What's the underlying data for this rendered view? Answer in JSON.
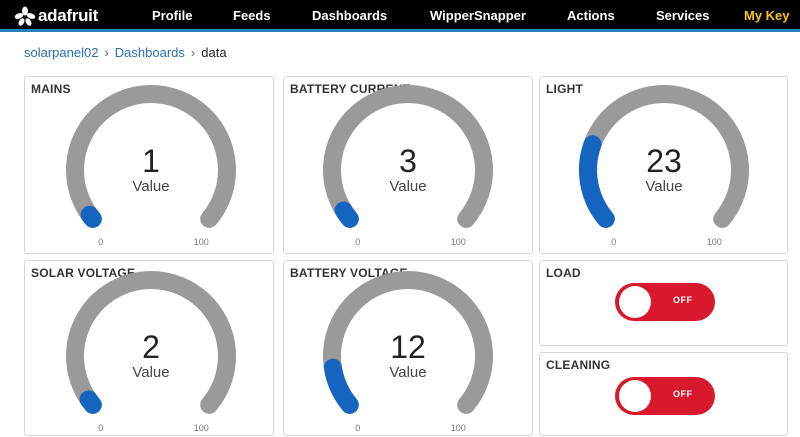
{
  "brand": {
    "name": "adafruit",
    "logo_icon": "adafruit-flower-icon"
  },
  "nav": {
    "items": [
      {
        "label": "Profile"
      },
      {
        "label": "Feeds"
      },
      {
        "label": "Dashboards"
      },
      {
        "label": "WipperSnapper"
      },
      {
        "label": "Actions"
      },
      {
        "label": "Services"
      },
      {
        "label": "My Key",
        "accent": true
      }
    ]
  },
  "breadcrumb": {
    "items": [
      "solarpanel02",
      "Dashboards"
    ],
    "current": "data",
    "separator": "›"
  },
  "colors": {
    "gauge_track": "#9a9a9a",
    "gauge_fill": "#1565c0",
    "toggle_off": "#d8192d",
    "nav_accent": "#f5c518",
    "link": "#2a6fb0"
  },
  "gauges": {
    "mains": {
      "title": "MAINS",
      "value": "1",
      "label": "Value",
      "min": "0",
      "max": "100",
      "fraction": 0.01
    },
    "battery_current": {
      "title": "BATTERY CURRENT",
      "value": "3",
      "label": "Value",
      "min": "0",
      "max": "100",
      "fraction": 0.03
    },
    "light": {
      "title": "LIGHT",
      "value": "23",
      "label": "Value",
      "min": "0",
      "max": "100",
      "fraction": 0.23
    },
    "solar_voltage": {
      "title": "SOLAR VOLTAGE",
      "value": "2",
      "label": "Value",
      "min": "0",
      "max": "100",
      "fraction": 0.02
    },
    "battery_voltage": {
      "title": "BATTERY VOLTAGE",
      "value": "12",
      "label": "Value",
      "min": "0",
      "max": "100",
      "fraction": 0.12
    }
  },
  "toggles": {
    "load": {
      "title": "LOAD",
      "state": "OFF"
    },
    "cleaning": {
      "title": "CLEANING",
      "state": "OFF"
    }
  }
}
